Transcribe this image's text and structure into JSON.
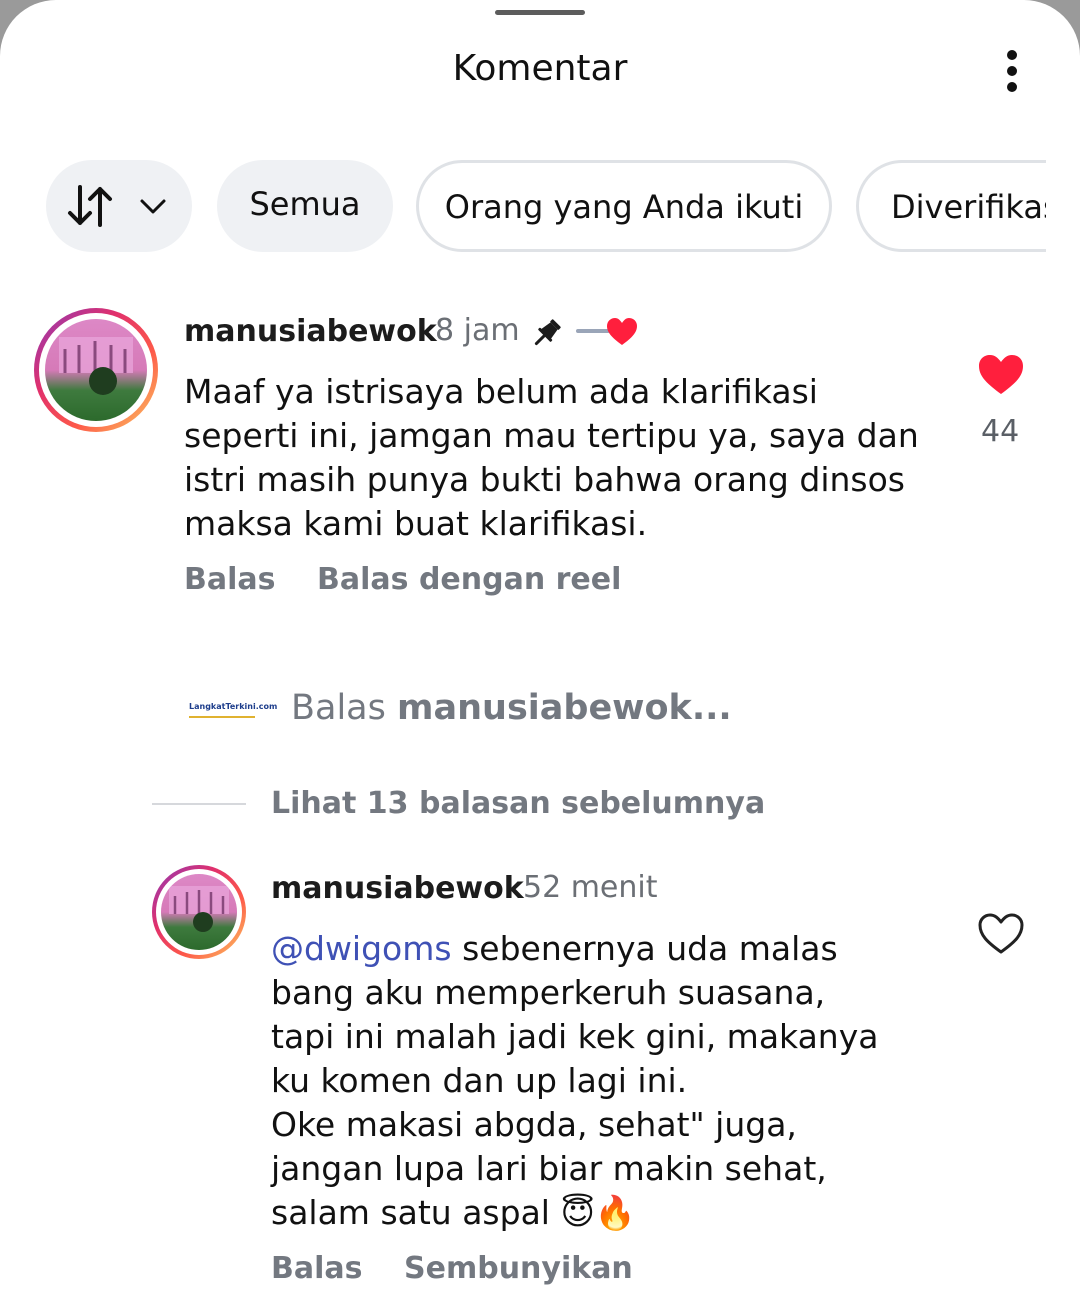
{
  "header": {
    "title": "Komentar",
    "more_icon": "more-vertical-icon"
  },
  "filters": {
    "sort_icon": "sort-arrows-icon",
    "sort_chevron_icon": "chevron-down-icon",
    "items": [
      {
        "label": "Semua"
      },
      {
        "label": "Orang yang Anda ikuti"
      },
      {
        "label": "Diverifikas"
      }
    ]
  },
  "comment": {
    "username": "manusiabewok",
    "time": "8 jam",
    "pin_icon": "pin-icon",
    "creator_like_icon": "creator-liked-heart-icon",
    "text": "Maaf ya istrisaya belum ada klarifikasi seperti ini, jamgan mau tertipu ya, saya dan istri masih punya bukti bahwa orang dinsos maksa kami buat klarifikasi.",
    "like_count": "44",
    "liked": true,
    "like_color": "#ff1f3d",
    "actions": {
      "reply": "Balas",
      "reply_reel": "Balas dengan reel"
    }
  },
  "reply_box": {
    "logo_text": "LangkatTerkini.com",
    "prefix": "Balas",
    "target": "manusiabewok..."
  },
  "view_previous": "Lihat 13 balasan sebelumnya",
  "reply": {
    "username": "manusiabewok",
    "time": "52 menit",
    "mention": "@dwigoms",
    "lines": [
      " sebenernya uda malas",
      "bang aku memperkeruh suasana,",
      "tapi ini malah jadi kek gini, makanya",
      "ku komen dan up lagi ini.",
      "Oke makasi abgda, sehat\" juga,",
      "jangan lupa lari biar makin sehat,",
      "salam satu aspal 😇🔥"
    ],
    "like_icon": "heart-outline-icon",
    "actions": {
      "reply": "Balas",
      "hide": "Sembunyikan"
    }
  },
  "colors": {
    "accent_link": "#3f51b5",
    "muted": "#737880",
    "heart": "#ff1f3d"
  }
}
